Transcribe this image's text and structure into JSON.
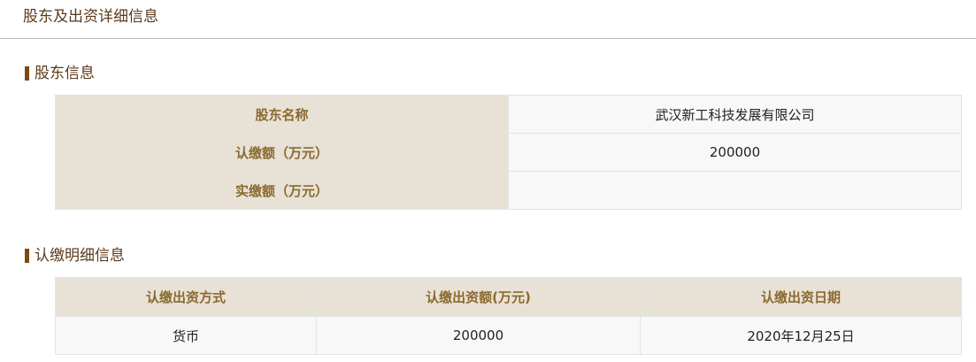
{
  "page": {
    "title": "股东及出资详细信息"
  },
  "shareholder_section": {
    "title": "股东信息",
    "rows": [
      {
        "label": "股东名称",
        "value": "武汉新工科技发展有限公司"
      },
      {
        "label": "认缴额（万元）",
        "value": "200000"
      },
      {
        "label": "实缴额（万元）",
        "value": ""
      }
    ]
  },
  "subscription_section": {
    "title": "认缴明细信息",
    "columns": [
      "认缴出资方式",
      "认缴出资额(万元)",
      "认缴出资日期"
    ],
    "rows": [
      [
        "货币",
        "200000",
        "2020年12月25日"
      ]
    ]
  },
  "colors": {
    "title_text": "#5b3a1c",
    "section_bar": "#7a4a12",
    "label_bg": "#e8e1d6",
    "label_text": "#8a6a2e",
    "value_bg": "#f8f8f8"
  }
}
